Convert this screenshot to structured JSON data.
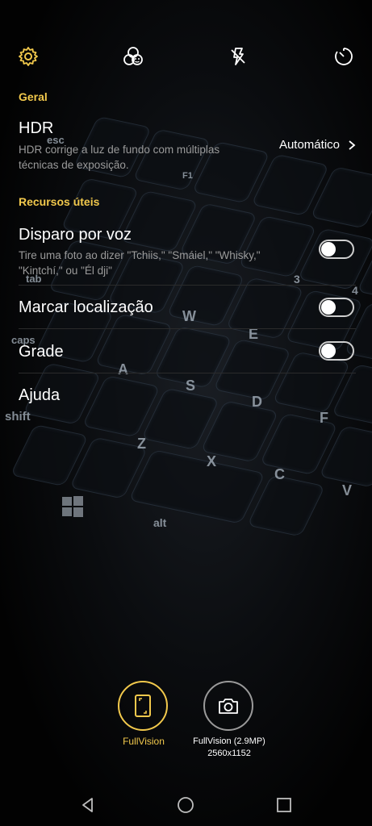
{
  "colors": {
    "accent": "#f2c94c",
    "text": "#ffffff",
    "muted": "#9a9a9a"
  },
  "topbar": {
    "icons": [
      "settings-gear-icon",
      "filters-icon",
      "flash-off-icon",
      "timer-icon"
    ]
  },
  "sections": {
    "general": "Geral",
    "resources": "Recursos úteis"
  },
  "hdr": {
    "title": "HDR",
    "desc_line1": "HDR corrige a luz de fundo com múltiplas",
    "desc_line2": "técnicas de exposição.",
    "value": "Automático"
  },
  "voice": {
    "title": "Disparo por voz",
    "desc_line1": "Tire uma foto ao dizer \"Tchiis,\" \"Smáiel,\" \"Whisky,\"",
    "desc_line2": "\"Kintchí,\" ou \"Él dji\"",
    "enabled": false
  },
  "location": {
    "title": "Marcar localização",
    "enabled": false
  },
  "grid": {
    "title": "Grade",
    "enabled": false
  },
  "help": {
    "title": "Ajuda"
  },
  "resolution": {
    "options": [
      {
        "label": "FullVision",
        "selected": true
      },
      {
        "label_line1": "FullVision (2.9MP)",
        "label_line2": "2560x1152",
        "selected": false
      }
    ]
  },
  "navbar": {
    "icons": [
      "back-icon",
      "home-icon",
      "recents-icon"
    ]
  },
  "background_keys": [
    "esc",
    "tab",
    "caps",
    "shift",
    "W",
    "E",
    "A",
    "S",
    "D",
    "F",
    "Z",
    "X",
    "C",
    "V",
    "alt",
    "F1",
    "4",
    "3"
  ]
}
